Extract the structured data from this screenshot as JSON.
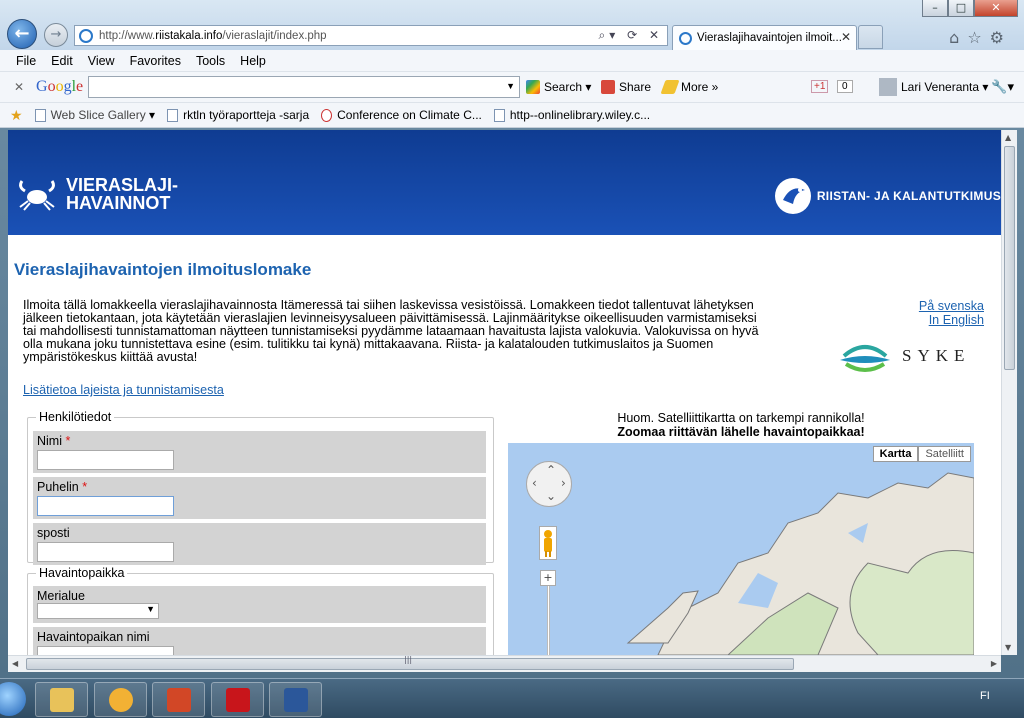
{
  "browser": {
    "url_prefix": "http://www.",
    "url_domain": "riistakala.info",
    "url_path": "/vieraslajit/index.php",
    "tab_title": "Vieraslajihavaintojen ilmoit...",
    "menu": [
      "File",
      "Edit",
      "View",
      "Favorites",
      "Tools",
      "Help"
    ],
    "google_toolbar": {
      "logo": "Google",
      "search_label": "Search",
      "share_label": "Share",
      "more_label": "More »",
      "plus_label": "+1",
      "plus_count": "0",
      "user_name": "Lari Veneranta"
    },
    "favorites": [
      "Web Slice Gallery",
      "rktln työraportteja -sarja",
      "Conference on Climate C...",
      "http--onlinelibrary.wiley.c..."
    ]
  },
  "site": {
    "logo_line1": "VIERASLAJI-",
    "logo_line2": "HAVAINNOT",
    "partner_logo": "RIISTAN- JA KALANTUTKIMUS",
    "form_title": "Vieraslajihavaintojen ilmoituslomake",
    "intro_lines": [
      "Ilmoita tällä lomakkeella vieraslajihavainnosta Itämeressä tai siihen laskevissa vesistöissä. Lomakkeen tiedot tallentuvat lähetyksen",
      "jälkeen tietokantaan, jota käytetään vieraslajien levinneisyysalueen päivittämisessä. Lajinmääritykse oikeellisuuden varmistamiseksi",
      "tai mahdollisesti tunnistamattoman näytteen tunnistamiseksi pyydämme lataamaan havaitusta lajista valokuvia. Valokuvissa on hyvä",
      "olla mukana joku tunnistettava esine (esim. tulitikku tai kynä) mittakaavana. Riista- ja kalatalouden tutkimuslaitos ja Suomen",
      "ympäristökeskus kiittää avusta!"
    ],
    "lang_swedish": "På svenska",
    "lang_english": "In English",
    "syke_text": "SYKE",
    "more_info_link": "Lisätietoa lajeista ja tunnistamisesta"
  },
  "form": {
    "personal_legend": "Henkilötiedot",
    "name_label": "Nimi",
    "phone_label": "Puhelin",
    "email_label": "sposti",
    "required_mark": "*",
    "place_legend": "Havaintopaikka",
    "sea_area_label": "Merialue",
    "place_name_label": "Havaintopaikan nimi"
  },
  "map": {
    "note_line1": "Huom. Satelliittikartta on tarkempi rannikolla!",
    "note_line2": "Zoomaa riittävän lähelle havaintopaikkaa!",
    "type_map": "Kartta",
    "type_satellite": "Satelliitt"
  },
  "taskbar": {
    "language": "FI"
  },
  "colors": {
    "header_blue": "#1a51b6",
    "title_blue": "#1d63b0",
    "required_red": "#dd1111"
  }
}
